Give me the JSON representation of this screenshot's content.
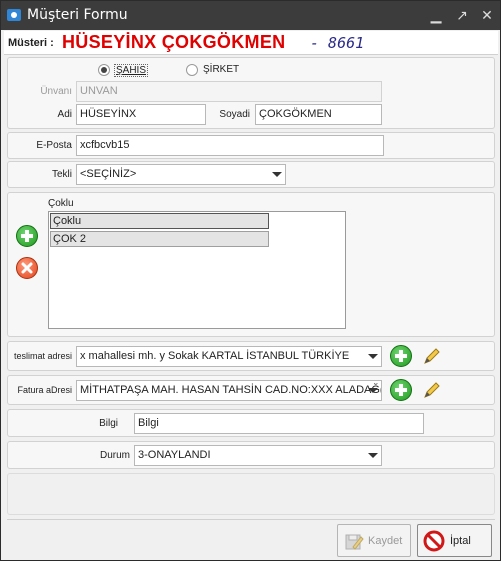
{
  "window": {
    "title": "Müşteri Formu"
  },
  "header": {
    "label": "Müsteri :",
    "customer_name": "HÜSEYİNX ÇOKGÖKMEN",
    "customer_code": "- 8661"
  },
  "customer_type": {
    "option_person": "ŞAHIS",
    "option_company": "ŞİRKET",
    "selected": "ŞAHIS"
  },
  "fields": {
    "unvan_label": "Ünvanı",
    "unvan_value": "UNVAN",
    "adi_label": "Adi",
    "adi_value": "HÜSEYİNX",
    "soyadi_label": "Soyadi",
    "soyadi_value": "ÇOKGÖKMEN",
    "eposta_label": "E-Posta",
    "eposta_value": "xcfbcvb15",
    "tekli_label": "Tekli",
    "tekli_value": "<SEÇİNİZ>",
    "coklu_label": "Çoklu",
    "coklu_items": [
      "Çoklu",
      "ÇOK 2"
    ],
    "teslimat_label": "teslimat adresi",
    "teslimat_value": "x mahallesi mh. y Sokak KARTAL İSTANBUL TÜRKİYE",
    "fatura_label": "Fatura aDresi",
    "fatura_value": "MİTHATPAŞA MAH. HASAN TAHSİN CAD.NO:XXX ALADAĞ(",
    "bilgi_label": "Bilgi",
    "bilgi_value": "Bilgi",
    "durum_label": "Durum",
    "durum_value": "3-ONAYLANDI"
  },
  "buttons": {
    "save": "Kaydet",
    "cancel": "İptal"
  },
  "colors": {
    "title_bar": "#3c3c3c",
    "customer_name": "#e00000",
    "add": "#2aa52a",
    "remove": "#e2441c"
  }
}
